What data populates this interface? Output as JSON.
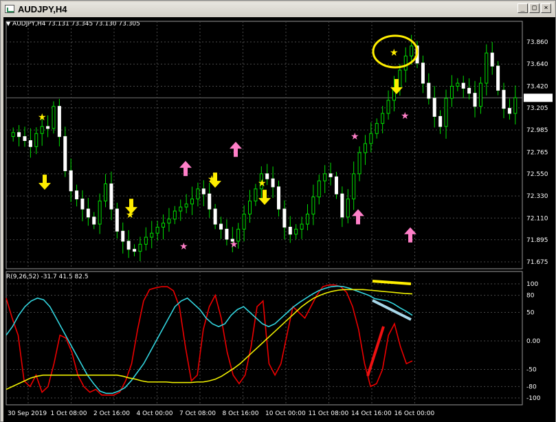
{
  "window": {
    "title": "AUDJPY,H4",
    "minimize_glyph": "_",
    "maximize_glyph": "□",
    "close_glyph": "×"
  },
  "price_panel": {
    "symbol_label": "AUDJPY,H4",
    "ohlc": "73.131 73.345 73.130 73.305",
    "current_price": "73.305",
    "y_ticks": [
      "73.860",
      "73.640",
      "73.420",
      "73.205",
      "72.985",
      "72.765",
      "72.550",
      "72.330",
      "72.110",
      "71.895",
      "71.675"
    ],
    "ylim": [
      71.675,
      73.86
    ]
  },
  "indicator_panel": {
    "label": "R(9,26,52) -31.7 41.5 82.5",
    "y_ticks": [
      "100",
      "80",
      "50",
      "0.00",
      "-50",
      "-80",
      "-100"
    ]
  },
  "x_ticks": [
    "30 Sep 2019",
    "1 Oct 08:00",
    "2 Oct 16:00",
    "4 Oct 00:00",
    "7 Oct 08:00",
    "8 Oct 16:00",
    "10 Oct 00:00",
    "11 Oct 08:00",
    "14 Oct 16:00",
    "16 Oct 00:00"
  ],
  "colors": {
    "background": "#000000",
    "candle": "#00e000",
    "candle_body": "#ffffff",
    "grid": "#4a4a4a",
    "sell_arrow": "#ffee00",
    "buy_arrow": "#ff7fc8",
    "line_fast": "#ee0000",
    "line_mid": "#33d6e0",
    "line_slow": "#f0f000"
  },
  "chart_data": {
    "type": "line",
    "title": "AUDJPY,H4",
    "closes": [
      72.96,
      72.92,
      72.88,
      72.82,
      72.95,
      73.02,
      73.0,
      73.22,
      72.92,
      72.58,
      72.38,
      72.3,
      72.2,
      72.12,
      72.05,
      72.28,
      72.45,
      72.2,
      71.98,
      71.88,
      71.8,
      71.78,
      71.85,
      71.92,
      71.96,
      72.02,
      72.06,
      72.1,
      72.18,
      72.22,
      72.25,
      72.3,
      72.4,
      72.35,
      72.2,
      72.05,
      72.0,
      71.9,
      71.88,
      72.0,
      72.15,
      72.28,
      72.4,
      72.55,
      72.5,
      72.42,
      72.2,
      72.02,
      71.95,
      72.0,
      72.05,
      72.15,
      72.32,
      72.48,
      72.55,
      72.52,
      72.35,
      72.12,
      72.3,
      72.55,
      72.76,
      72.85,
      72.95,
      73.05,
      73.15,
      73.28,
      73.4,
      73.58,
      73.72,
      73.82,
      73.65,
      73.45,
      73.3,
      73.12,
      73.02,
      73.3,
      73.42,
      73.45,
      73.4,
      73.35,
      73.22,
      73.45,
      73.75,
      73.62,
      73.38,
      73.2,
      73.15,
      73.305
    ],
    "indicator": {
      "name": "R(9,26,52)",
      "ylim": [
        -100,
        100
      ],
      "series": [
        {
          "name": "-31.7",
          "values": [
            75,
            40,
            10,
            -70,
            -80,
            -60,
            -90,
            -80,
            -40,
            10,
            5,
            -20,
            -60,
            -80,
            -90,
            -85,
            -95,
            -95,
            -95,
            -90,
            -70,
            -40,
            20,
            70,
            90,
            93,
            95,
            95,
            88,
            60,
            -10,
            -70,
            -60,
            20,
            60,
            80,
            40,
            -20,
            -60,
            -75,
            -60,
            -10,
            60,
            70,
            -40,
            -60,
            -40,
            10,
            60,
            50,
            40,
            60,
            80,
            95,
            98,
            98,
            95,
            85,
            60,
            20,
            -40,
            -80,
            -75,
            -50,
            10,
            30,
            -10,
            -40,
            -35
          ]
        },
        {
          "name": "41.5",
          "values": [
            10,
            25,
            45,
            60,
            70,
            75,
            72,
            60,
            40,
            20,
            0,
            -20,
            -40,
            -60,
            -75,
            -88,
            -92,
            -92,
            -88,
            -82,
            -70,
            -55,
            -40,
            -20,
            0,
            20,
            40,
            60,
            70,
            75,
            65,
            55,
            40,
            30,
            25,
            30,
            45,
            55,
            60,
            50,
            40,
            30,
            25,
            30,
            40,
            50,
            60,
            68,
            75,
            82,
            88,
            92,
            95,
            96,
            95,
            92,
            88,
            84,
            80,
            74,
            72,
            70,
            65,
            58,
            52,
            45
          ]
        },
        {
          "name": "82.5",
          "values": [
            -85,
            -80,
            -75,
            -70,
            -65,
            -62,
            -60,
            -60,
            -60,
            -60,
            -60,
            -60,
            -60,
            -60,
            -60,
            -60,
            -60,
            -60,
            -60,
            -62,
            -65,
            -67,
            -70,
            -72,
            -72,
            -72,
            -72,
            -73,
            -73,
            -73,
            -73,
            -72,
            -72,
            -70,
            -67,
            -62,
            -55,
            -48,
            -40,
            -30,
            -20,
            -10,
            0,
            10,
            20,
            30,
            40,
            50,
            60,
            68,
            75,
            80,
            84,
            87,
            89,
            90,
            90,
            90,
            90,
            89,
            88,
            87,
            86,
            85,
            84,
            83,
            82.5
          ]
        }
      ]
    }
  }
}
